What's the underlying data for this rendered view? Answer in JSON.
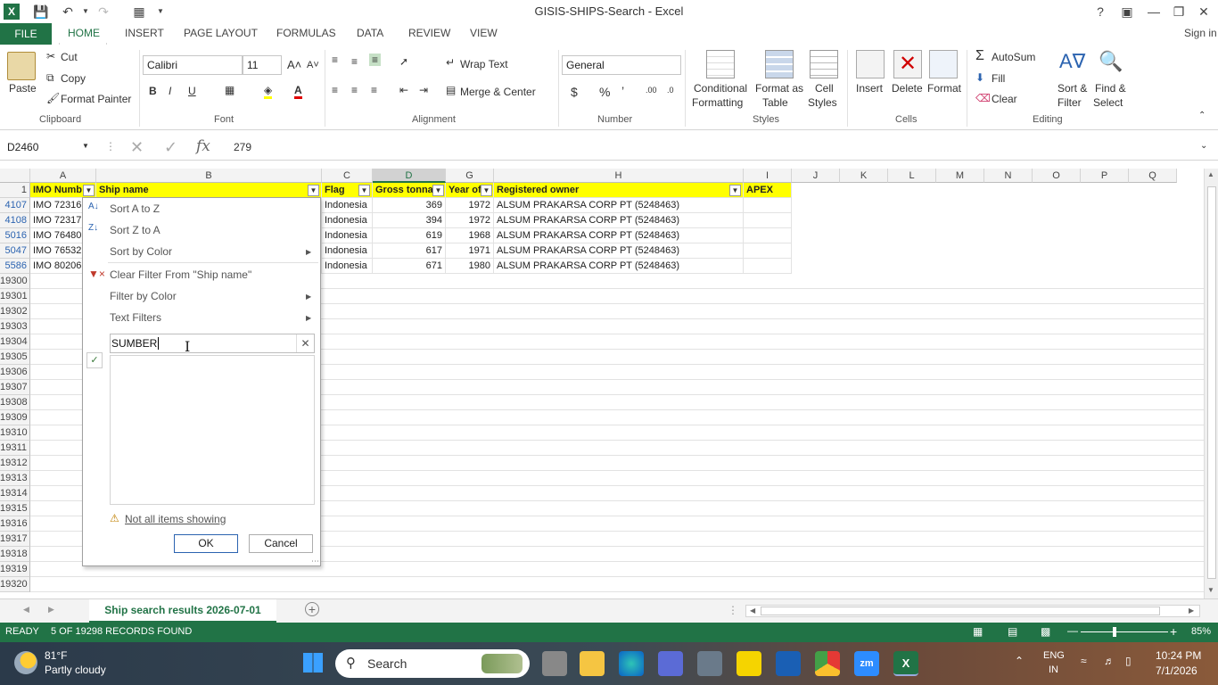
{
  "window": {
    "title": "GISIS-SHIPS-Search - Excel",
    "sign_in": "Sign in"
  },
  "tabs": [
    "FILE",
    "HOME",
    "INSERT",
    "PAGE LAYOUT",
    "FORMULAS",
    "DATA",
    "REVIEW",
    "VIEW"
  ],
  "ribbon": {
    "clipboard": {
      "paste": "Paste",
      "cut": "Cut",
      "copy": "Copy",
      "format_painter": "Format Painter",
      "group": "Clipboard"
    },
    "font": {
      "name": "Calibri",
      "size": "11",
      "group": "Font"
    },
    "alignment": {
      "wrap": "Wrap Text",
      "merge": "Merge & Center",
      "group": "Alignment"
    },
    "number": {
      "format": "General",
      "group": "Number"
    },
    "styles": {
      "conditional": "Conditional",
      "conditional2": "Formatting",
      "format_table": "Format as",
      "format_table2": "Table",
      "cell_styles": "Cell",
      "cell_styles2": "Styles",
      "group": "Styles"
    },
    "cells": {
      "insert": "Insert",
      "delete": "Delete",
      "format": "Format",
      "group": "Cells"
    },
    "editing": {
      "autosum": "AutoSum",
      "fill": "Fill",
      "clear": "Clear",
      "sort": "Sort &",
      "sort2": "Filter",
      "find": "Find &",
      "find2": "Select",
      "group": "Editing"
    }
  },
  "formula_bar": {
    "name_box": "D2460",
    "value": "279"
  },
  "columns": [
    "A",
    "B",
    "C",
    "D",
    "G",
    "H",
    "I",
    "J",
    "K",
    "L",
    "M",
    "N",
    "O",
    "P",
    "Q"
  ],
  "header_row": {
    "A": "IMO Numb",
    "B": "Ship name",
    "C": "Flag",
    "D": "Gross tonnag",
    "G": "Year of",
    "H": "Registered owner",
    "I": "APEX"
  },
  "rows": [
    {
      "rn": "4107",
      "a": "IMO 72316",
      "c": "Indonesia",
      "d": "369",
      "g": "1972",
      "h": "ALSUM PRAKARSA CORP PT (5248463)"
    },
    {
      "rn": "4108",
      "a": "IMO 72317",
      "c": "Indonesia",
      "d": "394",
      "g": "1972",
      "h": "ALSUM PRAKARSA CORP PT (5248463)"
    },
    {
      "rn": "5016",
      "a": "IMO 76480",
      "c": "Indonesia",
      "d": "619",
      "g": "1968",
      "h": "ALSUM PRAKARSA CORP PT (5248463)"
    },
    {
      "rn": "5047",
      "a": "IMO 76532",
      "c": "Indonesia",
      "d": "617",
      "g": "1971",
      "h": "ALSUM PRAKARSA CORP PT (5248463)"
    },
    {
      "rn": "5586",
      "a": "IMO 80206",
      "c": "Indonesia",
      "d": "671",
      "g": "1980",
      "h": "ALSUM PRAKARSA CORP PT (5248463)"
    }
  ],
  "empty_rows": [
    "19300",
    "19301",
    "19302",
    "19303",
    "19304",
    "19305",
    "19306",
    "19307",
    "19308",
    "19309",
    "19310",
    "19311",
    "19312",
    "19313",
    "19314",
    "19315",
    "19316",
    "19317",
    "19318",
    "19319",
    "19320"
  ],
  "dropdown": {
    "sort_az": "Sort A to Z",
    "sort_za": "Sort Z to A",
    "sort_color": "Sort by Color",
    "clear_filter": "Clear Filter From \"Ship name\"",
    "filter_color": "Filter by Color",
    "text_filters": "Text Filters",
    "search_value": "SUMBER",
    "not_all": "Not all items showing",
    "ok": "OK",
    "cancel": "Cancel"
  },
  "sheet_tab": "Ship search results 2026-07-01",
  "status": {
    "ready": "READY",
    "records": "5 OF 19298 RECORDS FOUND",
    "zoom": "85%"
  },
  "taskbar": {
    "temp": "81°F",
    "weather": "Partly cloudy",
    "search": "Search",
    "lang": "ENG",
    "lang2": "IN",
    "time": "10:24 PM",
    "date": "7/1/2026"
  },
  "colors": {
    "excel_green": "#217346",
    "header_yellow": "#ffff00"
  }
}
